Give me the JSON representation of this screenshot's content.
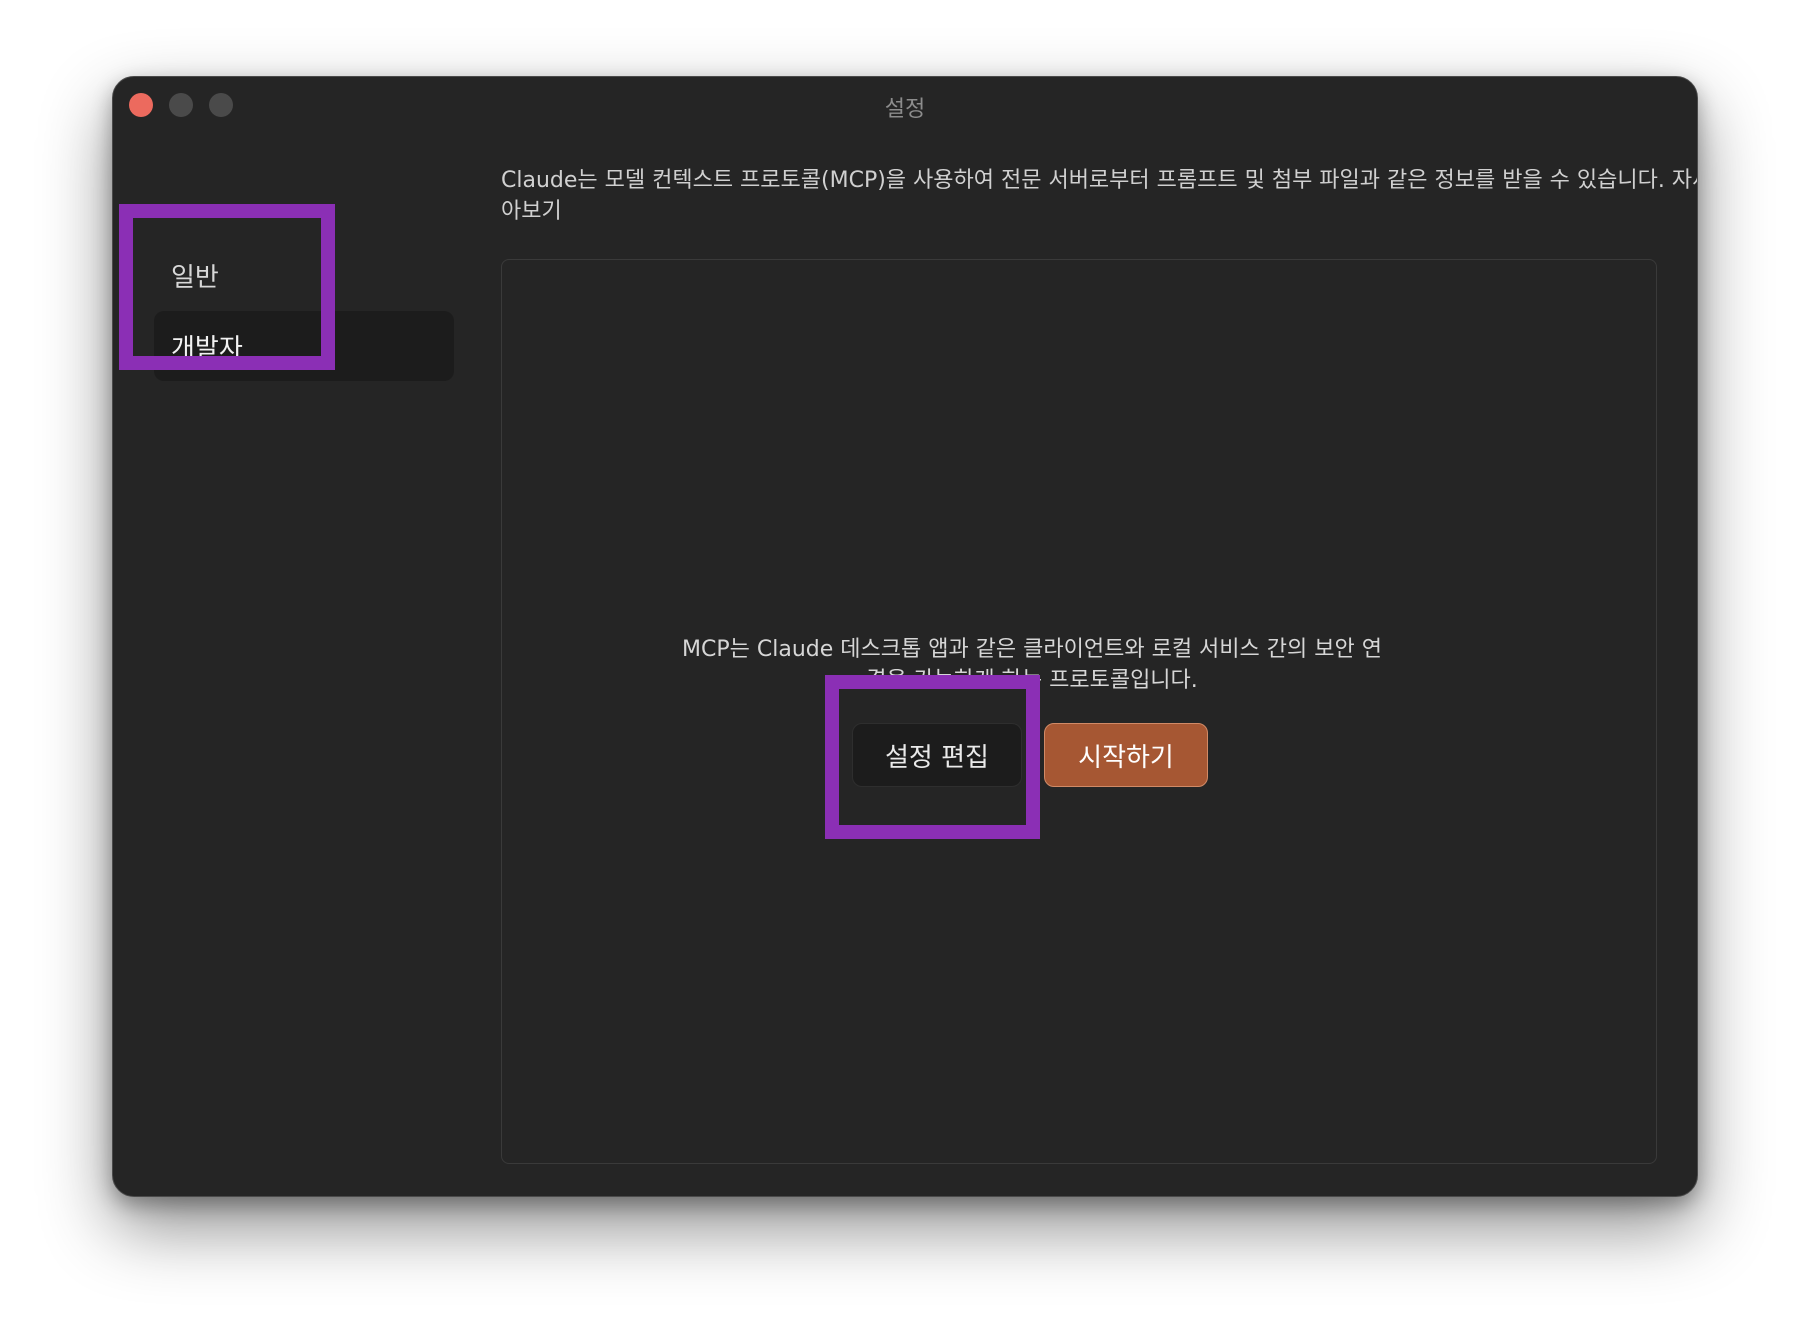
{
  "window": {
    "title": "설정"
  },
  "sidebar": {
    "items": [
      {
        "label": "일반"
      },
      {
        "label": "개발자"
      }
    ]
  },
  "main": {
    "intro_text": "Claude는 모델 컨텍스트 프로토콜(MCP)을 사용하여 전문 서버로부터 프롬프트 및 첨부 파일과 같은 정보를 받을 수 있습니다.",
    "learn_more": "자세히 알아보기",
    "empty_state": {
      "description": "MCP는 Claude 데스크톱 앱과 같은 클라이언트와 로컬 서비스 간의 보안 연결을 가능하게 하는 프로토콜입니다.",
      "edit_config_label": "설정 편집",
      "get_started_label": "시작하기"
    }
  },
  "colors": {
    "window_bg": "#252525",
    "accent_button": "#a65733",
    "highlight_box": "#8b2fb5",
    "close_button": "#ec6a5e"
  }
}
